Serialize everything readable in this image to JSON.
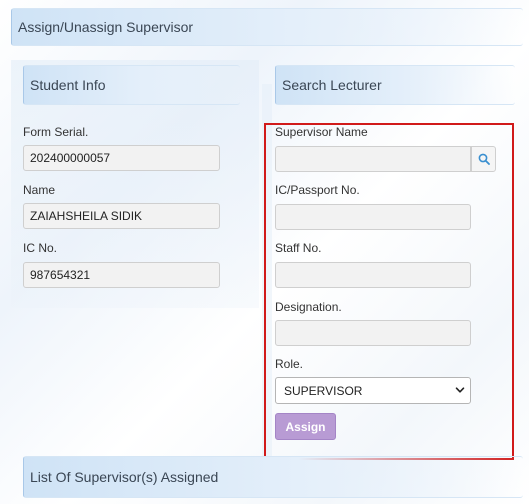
{
  "page": {
    "title": "Assign/Unassign Supervisor"
  },
  "student_info": {
    "header": "Student Info",
    "form_serial_label": "Form Serial.",
    "form_serial_value": "202400000057",
    "name_label": "Name",
    "name_value": "ZAIAHSHEILA SIDIK",
    "ic_label": "IC No.",
    "ic_value": "987654321"
  },
  "search_lecturer": {
    "header": "Search Lecturer",
    "supervisor_name_label": "Supervisor Name",
    "supervisor_name_value": "",
    "ic_passport_label": "IC/Passport No.",
    "ic_passport_value": "",
    "staff_no_label": "Staff No.",
    "staff_no_value": "",
    "designation_label": "Designation.",
    "designation_value": "",
    "role_label": "Role.",
    "role_selected": "SUPERVISOR",
    "assign_label": "Assign",
    "search_icon": "search-icon"
  },
  "assigned": {
    "header": "List Of Supervisor(s) Assigned"
  },
  "colors": {
    "highlight_border": "#d11a1a",
    "assign_button": "#b89bd4",
    "header_gradient": "#cfe3f6"
  }
}
